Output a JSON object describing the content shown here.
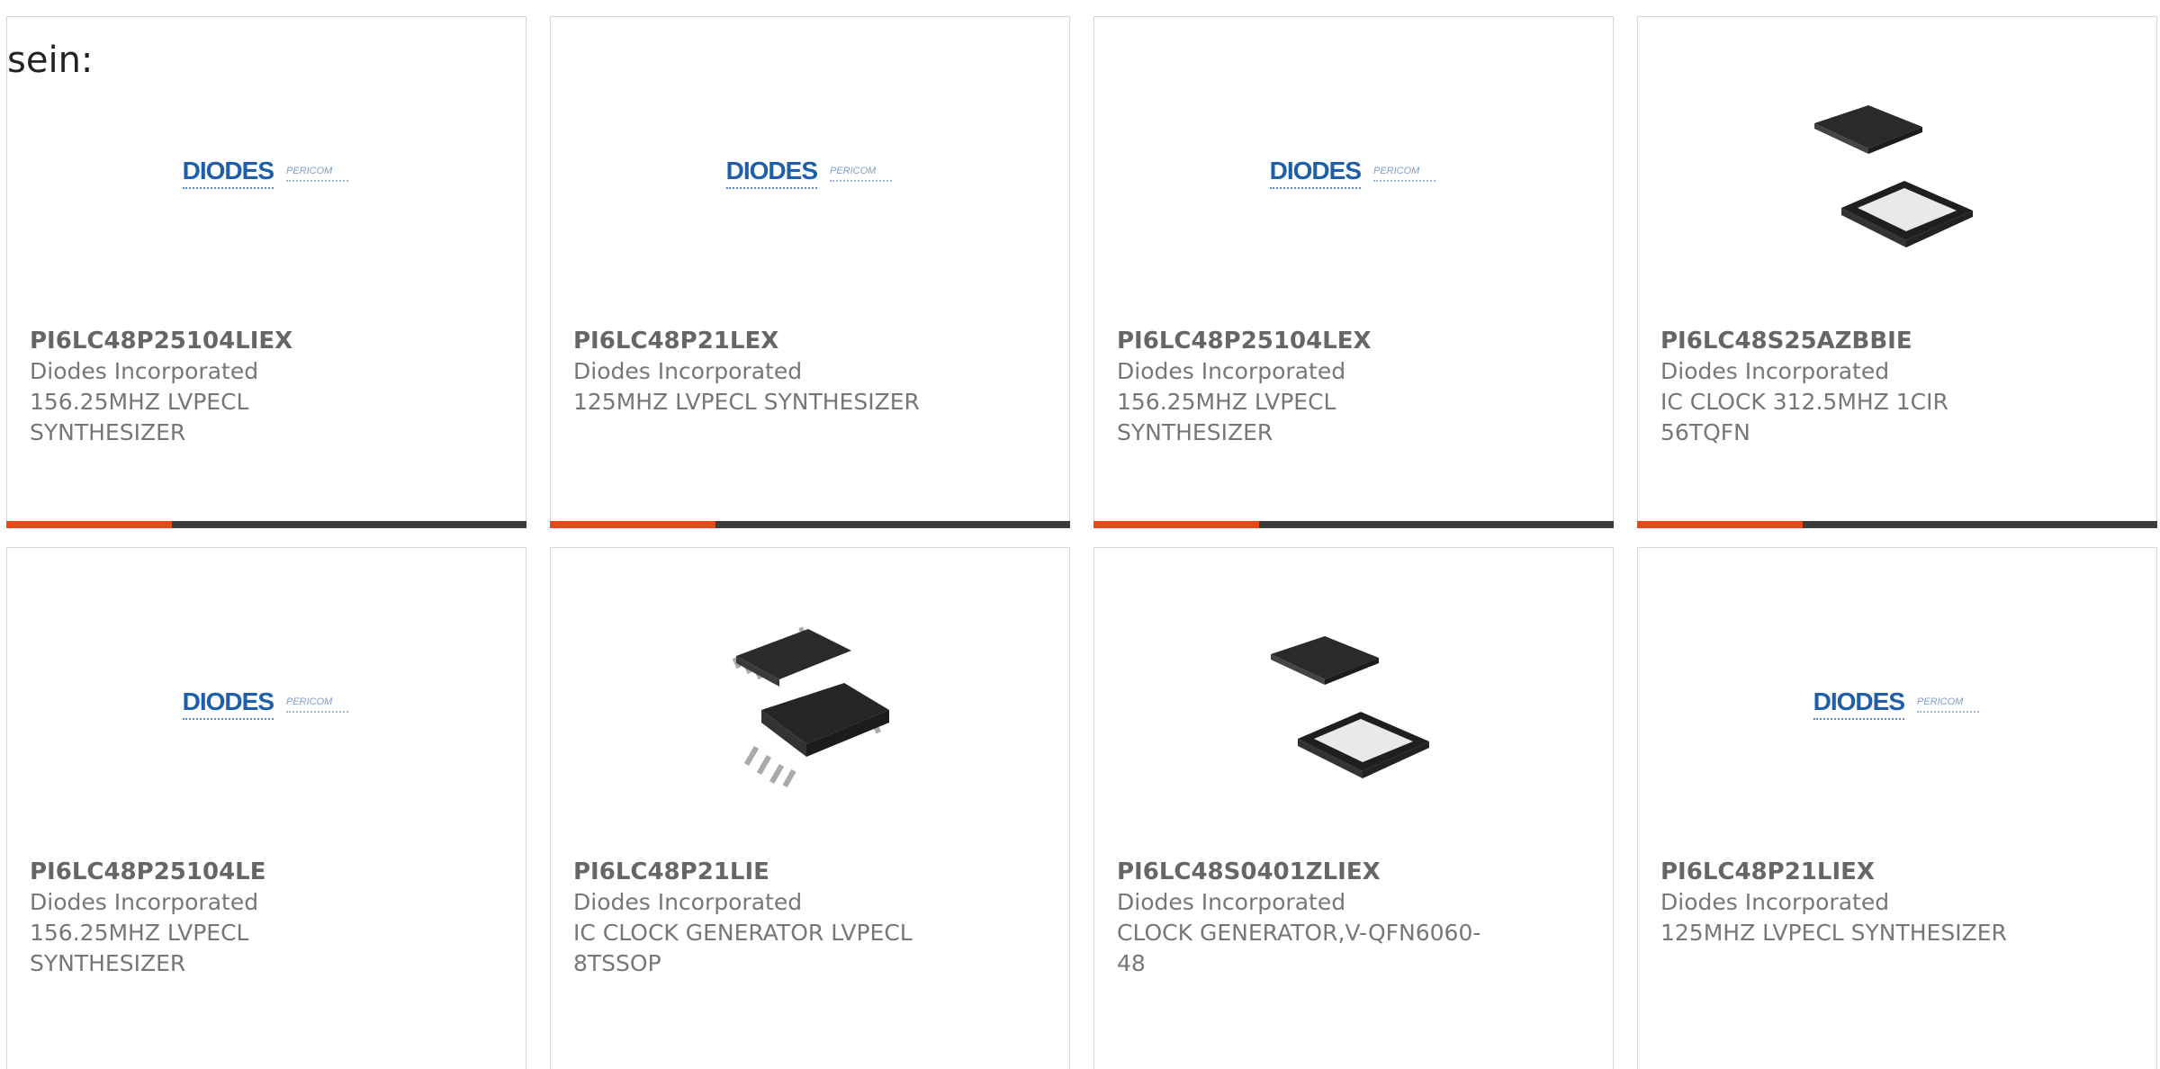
{
  "intro_text": "sein:",
  "colors": {
    "accent": "#e8471c",
    "bar": "#3c3c3c",
    "logo_blue": "#1f5fa8"
  },
  "logo": {
    "primary": "DIODES",
    "secondary": "PERICOM"
  },
  "products": [
    {
      "part": "PI6LC48P25104LIEX",
      "maker": "Diodes Incorporated",
      "desc": "156.25MHZ LVPECL SYNTHESIZER",
      "image": "diodes-logo"
    },
    {
      "part": "PI6LC48P21LEX",
      "maker": "Diodes Incorporated",
      "desc": "125MHZ LVPECL SYNTHESIZER",
      "image": "diodes-logo"
    },
    {
      "part": "PI6LC48P25104LEX",
      "maker": "Diodes Incorporated",
      "desc": "156.25MHZ LVPECL SYNTHESIZER",
      "image": "diodes-logo"
    },
    {
      "part": "PI6LC48S25AZBBIE",
      "maker": "Diodes Incorporated",
      "desc": "IC CLOCK 312.5MHZ 1CIR 56TQFN",
      "image": "qfn-chip"
    },
    {
      "part": "PI6LC48P25104LE",
      "maker": "Diodes Incorporated",
      "desc": "156.25MHZ LVPECL SYNTHESIZER",
      "image": "diodes-logo"
    },
    {
      "part": "PI6LC48P21LIE",
      "maker": "Diodes Incorporated",
      "desc": "IC CLOCK GENERATOR LVPECL 8TSSOP",
      "image": "tssop-chip"
    },
    {
      "part": "PI6LC48S0401ZLIEX",
      "maker": "Diodes Incorporated",
      "desc": "CLOCK GENERATOR,V-QFN6060-48",
      "image": "qfn-chip"
    },
    {
      "part": "PI6LC48P21LIEX",
      "maker": "Diodes Incorporated",
      "desc": "125MHZ LVPECL SYNTHESIZER",
      "image": "diodes-logo"
    }
  ]
}
